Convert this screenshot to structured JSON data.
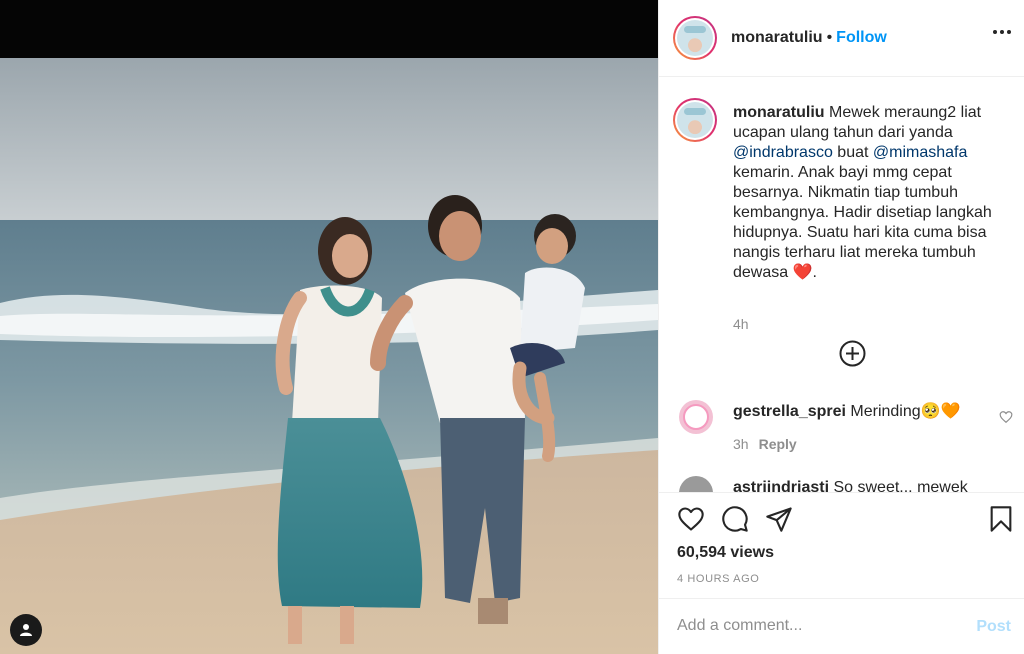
{
  "post": {
    "username": "monaratuliu",
    "follow_label": "Follow",
    "separator": "•"
  },
  "caption": {
    "username": "monaratuliu",
    "text_1": "Mewek meraung2 liat ucapan ulang tahun dari yanda ",
    "mention_1": "@indrabrasco",
    "text_2": " buat ",
    "mention_2": "@mimashafa",
    "text_3": " kemarin. Anak bayi mmg cepat besarnya. Nikmatin tiap tumbuh kembangnya. Hadir disetiap langkah hidupnya. Suatu hari kita cuma bisa nangis terharu liat mereka tumbuh dewasa ",
    "emoji": "❤️",
    "text_4": ".",
    "time": "4h"
  },
  "comments": [
    {
      "username": "gestrella_sprei",
      "text": " Merinding🥺🧡",
      "time": "3h",
      "reply_label": "Reply"
    },
    {
      "username": "astriindriasti",
      "text": " So sweet... mewek"
    }
  ],
  "stats": {
    "views": "60,594 views",
    "time_ago": "4 HOURS AGO"
  },
  "add_comment": {
    "placeholder": "Add a comment...",
    "post_label": "Post"
  },
  "icons": {
    "more": "more-options-icon",
    "load_more": "plus-circle-icon",
    "like": "heart-icon",
    "comment": "comment-icon",
    "share": "paper-plane-icon",
    "save": "bookmark-icon",
    "tag": "user-tag-icon"
  },
  "colors": {
    "link": "#0095f6",
    "mention": "#00376b",
    "muted": "#8e8e8e",
    "post_disabled": "#b2dffc"
  }
}
